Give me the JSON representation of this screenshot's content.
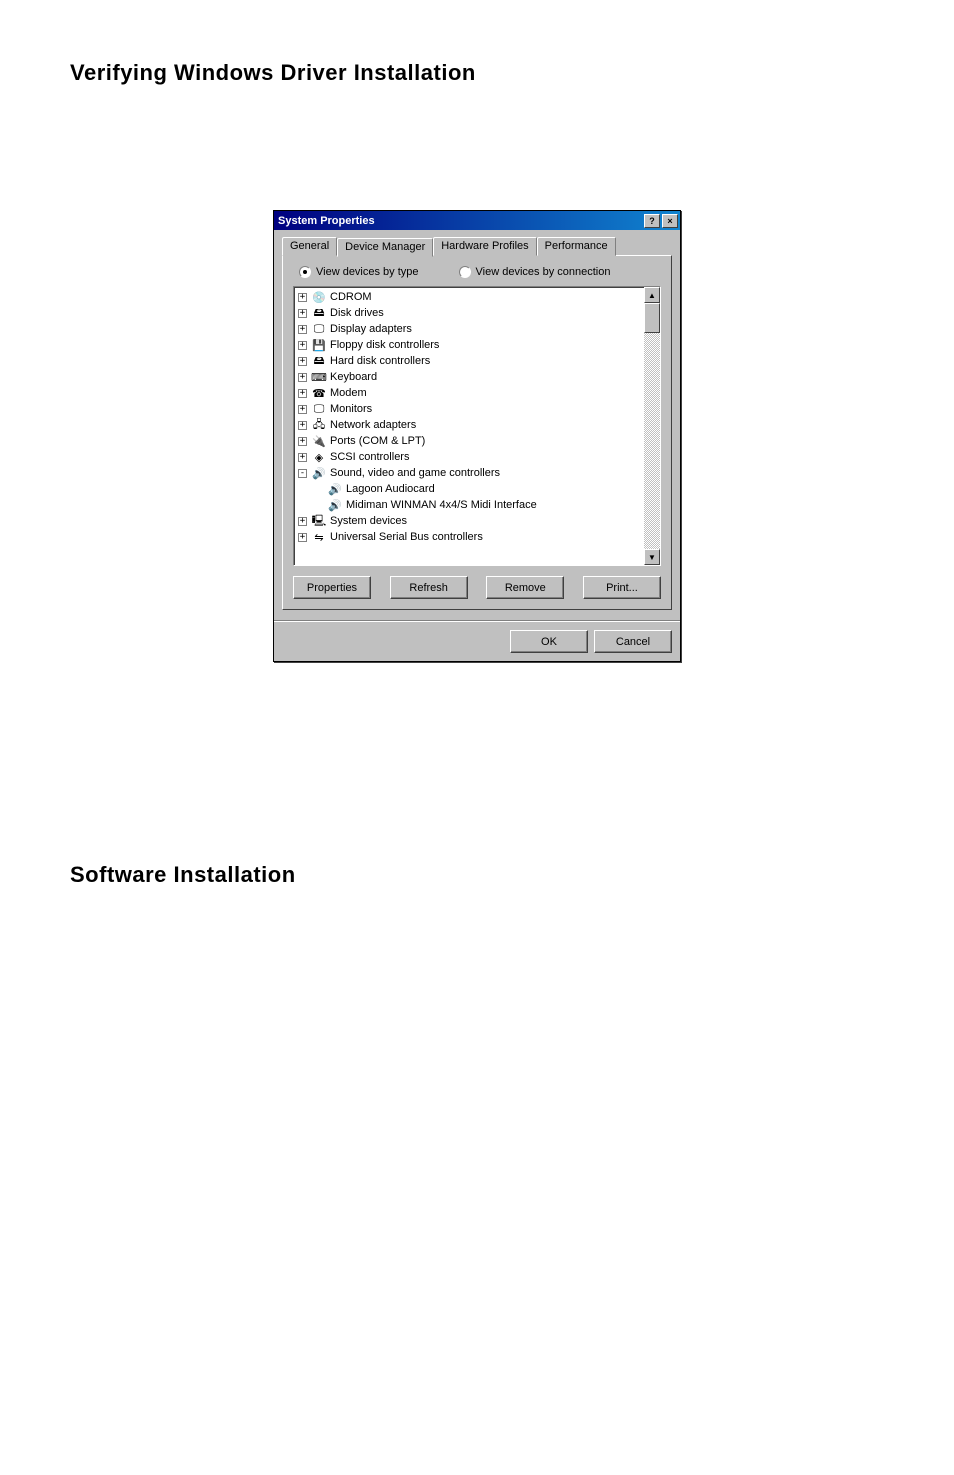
{
  "headings": {
    "h1": "Verifying Windows Driver Installation",
    "h2": "Software Installation"
  },
  "dialog": {
    "title": "System Properties",
    "titlebar_help": "?",
    "titlebar_close": "×",
    "tabs": {
      "general": "General",
      "device_manager": "Device Manager",
      "hardware_profiles": "Hardware Profiles",
      "performance": "Performance"
    },
    "radios": {
      "by_type": "View devices by type",
      "by_connection": "View devices by connection"
    },
    "tree": [
      {
        "exp": "+",
        "indent": 0,
        "icon": "cdrom-icon",
        "label": "CDROM"
      },
      {
        "exp": "+",
        "indent": 0,
        "icon": "disk-icon",
        "label": "Disk drives"
      },
      {
        "exp": "+",
        "indent": 0,
        "icon": "display-icon",
        "label": "Display adapters"
      },
      {
        "exp": "+",
        "indent": 0,
        "icon": "floppy-icon",
        "label": "Floppy disk controllers"
      },
      {
        "exp": "+",
        "indent": 0,
        "icon": "hdd-icon",
        "label": "Hard disk controllers"
      },
      {
        "exp": "+",
        "indent": 0,
        "icon": "keyboard-icon",
        "label": "Keyboard"
      },
      {
        "exp": "+",
        "indent": 0,
        "icon": "modem-icon",
        "label": "Modem"
      },
      {
        "exp": "+",
        "indent": 0,
        "icon": "monitor-icon",
        "label": "Monitors"
      },
      {
        "exp": "+",
        "indent": 0,
        "icon": "network-icon",
        "label": "Network adapters"
      },
      {
        "exp": "+",
        "indent": 0,
        "icon": "ports-icon",
        "label": "Ports (COM & LPT)"
      },
      {
        "exp": "+",
        "indent": 0,
        "icon": "scsi-icon",
        "label": "SCSI controllers"
      },
      {
        "exp": "-",
        "indent": 0,
        "icon": "sound-icon",
        "label": "Sound, video and game controllers"
      },
      {
        "exp": "",
        "indent": 1,
        "icon": "sound-icon",
        "label": "Lagoon Audiocard"
      },
      {
        "exp": "",
        "indent": 1,
        "icon": "sound-icon",
        "label": "Midiman WINMAN 4x4/S Midi Interface"
      },
      {
        "exp": "+",
        "indent": 0,
        "icon": "system-icon",
        "label": "System devices"
      },
      {
        "exp": "+",
        "indent": 0,
        "icon": "usb-icon",
        "label": "Universal Serial Bus controllers"
      }
    ],
    "buttons": {
      "properties": "Properties",
      "refresh": "Refresh",
      "remove": "Remove",
      "print": "Print...",
      "ok": "OK",
      "cancel": "Cancel"
    }
  },
  "icon_glyphs": {
    "cdrom-icon": "💿",
    "disk-icon": "🖴",
    "display-icon": "🖵",
    "floppy-icon": "💾",
    "hdd-icon": "🖴",
    "keyboard-icon": "⌨",
    "modem-icon": "☎",
    "monitor-icon": "🖵",
    "network-icon": "🖧",
    "ports-icon": "🔌",
    "scsi-icon": "◈",
    "sound-icon": "🔊",
    "system-icon": "🖳",
    "usb-icon": "⇋"
  }
}
